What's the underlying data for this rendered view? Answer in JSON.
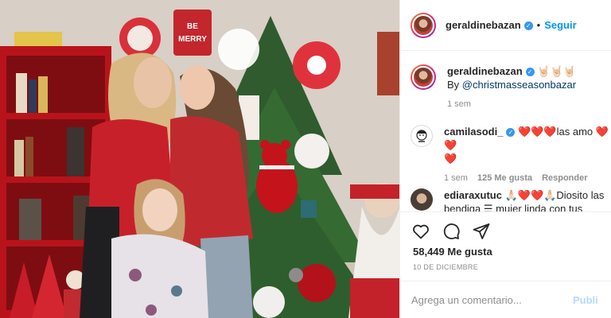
{
  "post": {
    "username": "geraldinebazan",
    "follow_label": "Seguir",
    "separator": "•",
    "verified_mark": "✓"
  },
  "photo": {
    "sign_text": "BE MERRY",
    "colors": {
      "tree": "#2f5b2e",
      "sweater": "#c8202a",
      "jacket": "#c02a2f",
      "shelf": "#b8131b"
    }
  },
  "caption": {
    "username": "geraldinebazan",
    "emojis": "🤘🏻🤘🏻🤘🏻",
    "text_prefix": "By ",
    "mention": "@christmasseasonbazar",
    "time": "1 sem"
  },
  "comments": [
    {
      "username": "camilasodi_",
      "hearts_before": "❤️❤️❤️",
      "text": "las amo",
      "hearts_after": "❤️❤️",
      "hearts_line": "❤️",
      "time": "1 sem",
      "likes": "125 Me gusta",
      "reply": "Responder"
    },
    {
      "username": "ediaraxutuc",
      "emojis": "🙏🏻❤️❤️🙏🏻",
      "text": "Diosito las bendiga",
      "emoji_mid": "☰",
      "text2": " mujer linda con tus"
    }
  ],
  "actions": {
    "icons": [
      "heart-icon",
      "comment-icon",
      "share-icon"
    ],
    "likes": "58,449 Me gusta",
    "date": "10 DE DICIEMBRE",
    "comment_placeholder": "Agrega un comentario...",
    "publish_label": "Publi"
  },
  "accent": "#0095f6"
}
